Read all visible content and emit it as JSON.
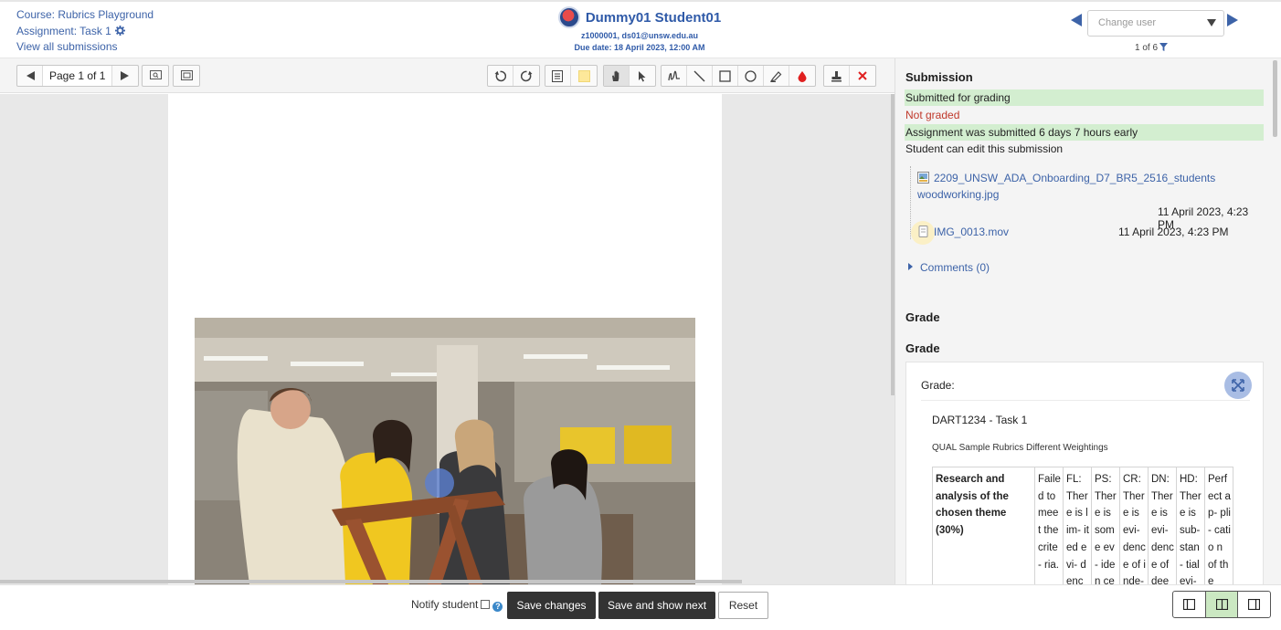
{
  "header": {
    "course_link": "Course: Rubrics Playground",
    "assignment_link": "Assignment: Task 1",
    "view_all": "View all submissions",
    "user_name": "Dummy01 Student01",
    "user_ids": "z1000001, ds01@unsw.edu.au",
    "due_date": "Due date: 18 April 2023, 12:00 AM",
    "change_user_placeholder": "Change user",
    "pager_count": "1 of 6"
  },
  "toolbar": {
    "page_label": "Page 1 of 1"
  },
  "submission": {
    "title": "Submission",
    "status_submitted": "Submitted for grading",
    "status_grading": "Not graded",
    "status_time": "Assignment was submitted 6 days 7 hours early",
    "status_edit": "Student can edit this submission",
    "files": [
      {
        "name_line1": "2209_UNSW_ADA_Onboarding_D7_BR5_2516_students",
        "name_line2": "woodworking.jpg",
        "date": "11 April 2023, 4:23 PM"
      },
      {
        "name_line1": "IMG_0013.mov",
        "name_line2": "",
        "date": "11 April 2023, 4:23 PM"
      }
    ],
    "comments": "Comments (0)"
  },
  "grade": {
    "section_title": "Grade",
    "sub_title": "Grade",
    "grade_label": "Grade:",
    "rubric_name": "DART1234 - Task 1",
    "rubric_desc": "QUAL Sample Rubrics Different Weightings",
    "criterion": "Research and analysis of the chosen theme (30%)",
    "levels": [
      "Faile d to meet the crite- ria.",
      "FL: Ther e is lim- ited evi- denc",
      "PS: Ther e is som e ev- iden ce of",
      "CR: Ther e is evi- denc e of inde-",
      "DN: Ther e is evi- denc e of deep",
      "HD: Ther e is sub- stan- tial evi-",
      "Perf ect ap- pli- catio n of the"
    ]
  },
  "footer": {
    "notify_label": "Notify student",
    "save_changes": "Save changes",
    "save_next": "Save and show next",
    "reset": "Reset"
  },
  "colors": {
    "link_blue": "#3d63a8",
    "status_green": "#d3eed0",
    "not_graded_red": "#c0392b",
    "button_dark": "#333333",
    "layout_active": "#cbe8c2"
  }
}
